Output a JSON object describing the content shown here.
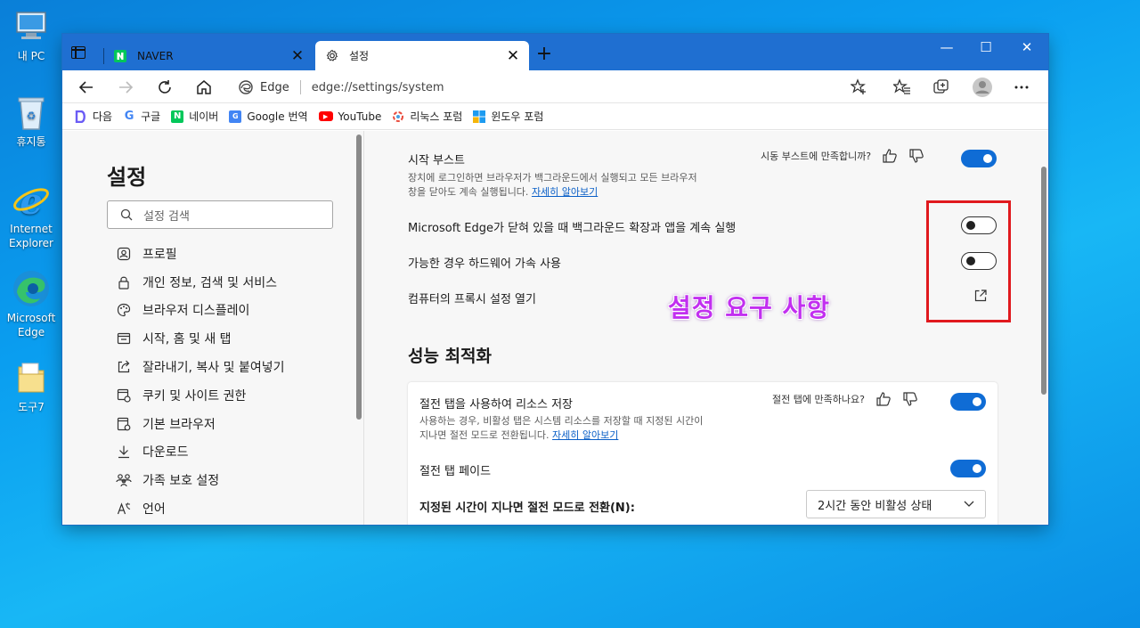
{
  "desktop": {
    "icons": [
      {
        "label": "내 PC"
      },
      {
        "label": "휴지통"
      },
      {
        "label": "Internet Explorer"
      },
      {
        "label": "Microsoft Edge"
      },
      {
        "label": "도구7"
      }
    ]
  },
  "tabs": [
    {
      "title": "NAVER",
      "favicon": "naver-icon"
    },
    {
      "title": "설정",
      "favicon": "gear-icon"
    }
  ],
  "address": {
    "brand": "Edge",
    "url": "edge://settings/system"
  },
  "bookmarks": [
    {
      "label": "다음",
      "icon": "daum-icon",
      "color": "#4e8cf5"
    },
    {
      "label": "구글",
      "icon": "google-icon",
      "color": "#4285f4"
    },
    {
      "label": "네이버",
      "icon": "naver-icon",
      "color": "#03c75a"
    },
    {
      "label": "Google 번역",
      "icon": "translate-icon",
      "color": "#4285f4"
    },
    {
      "label": "YouTube",
      "icon": "youtube-icon",
      "color": "#ff0000"
    },
    {
      "label": "리눅스 포럼",
      "icon": "linux-forum-icon",
      "color": "#e94b3c"
    },
    {
      "label": "윈도우 포럼",
      "icon": "windows-forum-icon",
      "color": "#0078d4"
    }
  ],
  "sidebar": {
    "title": "설정",
    "search_placeholder": "설정 검색",
    "items": [
      {
        "label": "프로필",
        "icon": "profile-icon"
      },
      {
        "label": "개인 정보, 검색 및 서비스",
        "icon": "lock-icon"
      },
      {
        "label": "브라우저 디스플레이",
        "icon": "palette-icon"
      },
      {
        "label": "시작, 홈 및 새 탭",
        "icon": "home-tab-icon"
      },
      {
        "label": "잘라내기, 복사 및 붙여넣기",
        "icon": "share-icon"
      },
      {
        "label": "쿠키 및 사이트 권한",
        "icon": "cookie-icon"
      },
      {
        "label": "기본 브라우저",
        "icon": "browser-icon"
      },
      {
        "label": "다운로드",
        "icon": "download-icon"
      },
      {
        "label": "가족 보호 설정",
        "icon": "family-icon"
      },
      {
        "label": "언어",
        "icon": "language-icon"
      }
    ]
  },
  "main": {
    "startup_boost": {
      "title": "시작 부스트",
      "desc_line1": "장치에 로그인하면 브라우저가 백그라운드에서 실행되고 모든 브라우저",
      "desc_line2": "창을 닫아도 계속 실행됩니다.",
      "link": "자세히 알아보기",
      "feedback": "시동 부스트에 만족합니까?",
      "enabled": true
    },
    "background_run": {
      "title": "Microsoft Edge가 닫혀 있을 때 백그라운드 확장과 앱을 계속 실행",
      "enabled": false
    },
    "hardware_accel": {
      "title": "가능한 경우 하드웨어 가속 사용",
      "enabled": false
    },
    "proxy": {
      "title": "컴퓨터의 프록시 설정 열기"
    },
    "annotation": "설정 요구 사항",
    "performance": {
      "section_title": "성능 최적화",
      "sleeping_tabs": {
        "title": "절전 탭을 사용하여 리소스 저장",
        "desc_line1": "사용하는 경우, 비활성 탭은 시스템 리소스를 저장할 때 지정된 시간이",
        "desc_line2": "지나면 절전 모드로 전환됩니다.",
        "link": "자세히 알아보기",
        "feedback": "절전 탭에 만족하나요?",
        "enabled": true
      },
      "fade_tabs": {
        "title": "절전 탭 페이드",
        "enabled": true
      },
      "timeout": {
        "title": "지정된 시간이 지나면 절전 모드로 전환(N):",
        "selected": "2시간 동안 비활성 상태"
      }
    }
  },
  "colors": {
    "accent": "#0f6cd5",
    "titlebar": "#1f6fd1",
    "highlight_box": "#e0191e",
    "annotation": "#c22ff0"
  }
}
